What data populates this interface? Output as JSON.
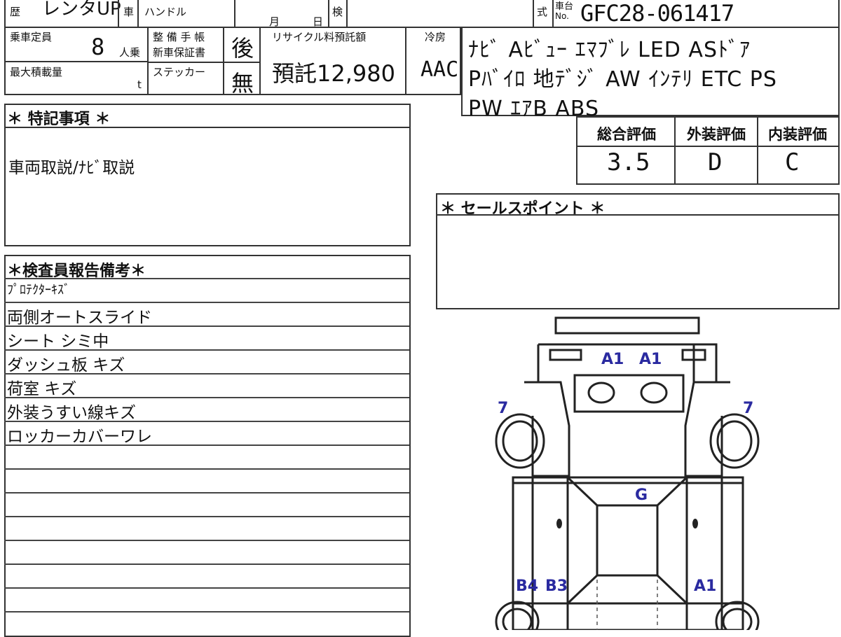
{
  "top": {
    "history_label": "歴",
    "history_value": "レンタUP",
    "car_label": "車",
    "handle_label": "ハンドル",
    "month_label": "月",
    "day_label": "日",
    "inspection_label": "検",
    "type_label": "式",
    "chassis_label_1": "車台",
    "chassis_label_2": "No.",
    "chassis_no": "GFC28-061417"
  },
  "row2": {
    "capacity_label": "乗車定員",
    "capacity_value": "8",
    "capacity_unit": "人乗",
    "warranty_label_1": "整 備 手 帳",
    "warranty_label_2": "新車保証書",
    "warranty_value": "後",
    "recycle_label": "リサイクル料預託額",
    "recycle_value": "預託12,980",
    "ac_label": "冷房",
    "ac_value": "AAC",
    "max_load_label": "最大積載量",
    "max_load_unit": "t",
    "sticker_label": "ステッカー",
    "sticker_value": "無"
  },
  "equipment": {
    "line1": "ﾅﾋﾞ Aﾋﾞｭｰ ｴﾏﾌﾞﾚ LED ASﾄﾞｱ",
    "line2": "Pﾊﾞｲﾛ 地ﾃﾞｼﾞ AW ｲﾝﾃﾘ ETC PS",
    "line3": "PW ｴｱB ABS"
  },
  "special_notes": {
    "header": "＊ 特記事項 ＊",
    "content": "車両取説/ﾅﾋﾞ取説"
  },
  "grades": {
    "overall_label": "総合評価",
    "overall_value": "3.5",
    "exterior_label": "外装評価",
    "exterior_value": "D",
    "interior_label": "内装評価",
    "interior_value": "C"
  },
  "sales_point": {
    "header": "＊ セールスポイント ＊"
  },
  "inspector": {
    "header": "＊検査員報告備考＊",
    "lines": [
      "ﾌﾟﾛﾃｸﾀｰｷｽﾞ",
      "両側オートスライド",
      "シート シミ中",
      "ダッシュ板 キズ",
      "荷室 キズ",
      "外装うすい線キズ",
      "ロッカーカバーワレ"
    ]
  },
  "diagram": {
    "marks": {
      "a1_left": "A1",
      "a1_right": "A1",
      "seven_left": "7",
      "seven_right": "7",
      "g": "G",
      "b4": "B4",
      "b3": "B3",
      "a1_bottom": "A1"
    },
    "mark_color": "#2a2aa0"
  }
}
